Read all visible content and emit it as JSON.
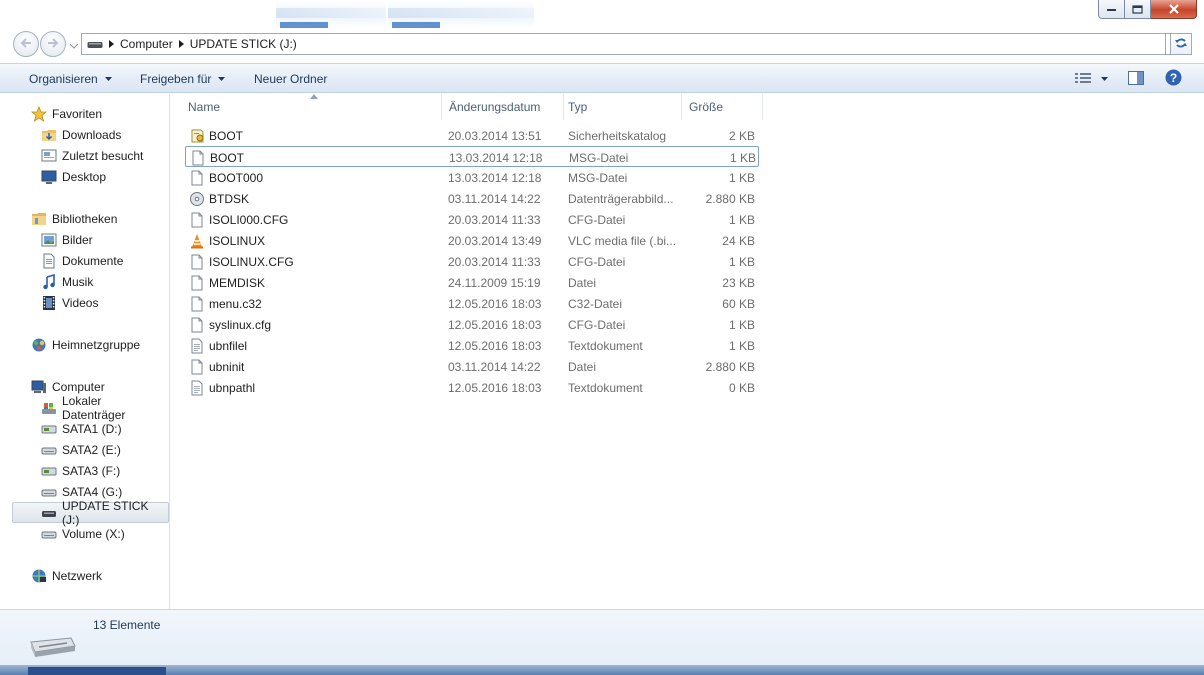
{
  "window": {
    "buttons": {
      "minimize": "minimize-icon",
      "maximize": "maximize-icon",
      "close": "close-icon"
    }
  },
  "address": {
    "breadcrumb": [
      "Computer",
      "UPDATE STICK (J:)"
    ]
  },
  "toolbar": {
    "organize_label": "Organisieren",
    "share_label": "Freigeben für",
    "new_folder_label": "Neuer Ordner"
  },
  "nav": {
    "favorites": {
      "label": "Favoriten",
      "items": [
        "Downloads",
        "Zuletzt besucht",
        "Desktop"
      ]
    },
    "libraries": {
      "label": "Bibliotheken",
      "items": [
        "Bilder",
        "Dokumente",
        "Musik",
        "Videos"
      ]
    },
    "homegroup": {
      "label": "Heimnetzgruppe"
    },
    "computer": {
      "label": "Computer",
      "items": [
        "Lokaler Datenträger",
        "SATA1 (D:)",
        "SATA2 (E:)",
        "SATA3 (F:)",
        "SATA4 (G:)",
        "UPDATE STICK (J:)",
        "Volume (X:)"
      ],
      "selected": "UPDATE STICK (J:)"
    },
    "network": {
      "label": "Netzwerk"
    }
  },
  "columns": [
    "Name",
    "Änderungsdatum",
    "Typ",
    "Größe"
  ],
  "files": [
    {
      "name": "BOOT",
      "date": "20.03.2014 13:51",
      "type": "Sicherheitskatalog",
      "size": "2 KB",
      "icon": "catalog-icon"
    },
    {
      "name": "BOOT",
      "date": "13.03.2014 12:18",
      "type": "MSG-Datei",
      "size": "1 KB",
      "icon": "file-icon"
    },
    {
      "name": "BOOT000",
      "date": "13.03.2014 12:18",
      "type": "MSG-Datei",
      "size": "1 KB",
      "icon": "file-icon"
    },
    {
      "name": "BTDSK",
      "date": "03.11.2014 14:22",
      "type": "Datenträgerabbild...",
      "size": "2.880 KB",
      "icon": "disc-image-icon"
    },
    {
      "name": "ISOLI000.CFG",
      "date": "20.03.2014 11:33",
      "type": "CFG-Datei",
      "size": "1 KB",
      "icon": "file-icon"
    },
    {
      "name": "ISOLINUX",
      "date": "20.03.2014 13:49",
      "type": "VLC media file (.bi...",
      "size": "24 KB",
      "icon": "vlc-icon"
    },
    {
      "name": "ISOLINUX.CFG",
      "date": "20.03.2014 11:33",
      "type": "CFG-Datei",
      "size": "1 KB",
      "icon": "file-icon"
    },
    {
      "name": "MEMDISK",
      "date": "24.11.2009 15:19",
      "type": "Datei",
      "size": "23 KB",
      "icon": "file-icon"
    },
    {
      "name": "menu.c32",
      "date": "12.05.2016 18:03",
      "type": "C32-Datei",
      "size": "60 KB",
      "icon": "file-icon"
    },
    {
      "name": "syslinux.cfg",
      "date": "12.05.2016 18:03",
      "type": "CFG-Datei",
      "size": "1 KB",
      "icon": "file-icon"
    },
    {
      "name": "ubnfilel",
      "date": "12.05.2016 18:03",
      "type": "Textdokument",
      "size": "1 KB",
      "icon": "text-file-icon"
    },
    {
      "name": "ubninit",
      "date": "03.11.2014 14:22",
      "type": "Datei",
      "size": "2.880 KB",
      "icon": "file-icon"
    },
    {
      "name": "ubnpathl",
      "date": "12.05.2016 18:03",
      "type": "Textdokument",
      "size": "0 KB",
      "icon": "text-file-icon"
    }
  ],
  "focused_row": 1,
  "status": {
    "count": "13 Elemente"
  },
  "colors": {
    "toolbar_text": "#1e395b",
    "selection_border": "#7da2ce"
  }
}
